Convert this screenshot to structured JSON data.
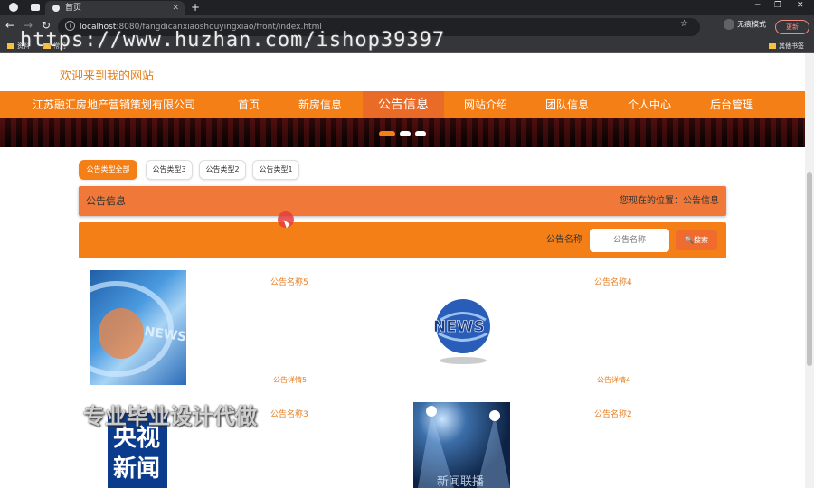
{
  "browser": {
    "tab_title": "首页",
    "url_host": "localhost",
    "url_rest": ":8080/fangdicanxiaoshouyingxiao/front/index.html",
    "incognito_label": "无痕模式",
    "update_label": "更新",
    "bookmarks": [
      "资料",
      "常用"
    ],
    "other_bookmarks": "其他书签"
  },
  "watermark": {
    "url": "https://www.huzhan.com/ishop39397",
    "bottom": "专业毕业设计代做"
  },
  "site": {
    "welcome": "欢迎来到我的网站",
    "company": "江苏融汇房地产营销策划有限公司",
    "nav": [
      "首页",
      "新房信息",
      "公告信息",
      "网站介绍",
      "团队信息",
      "个人中心",
      "后台管理"
    ],
    "nav_active_index": 2
  },
  "categories": [
    "公告类型全部",
    "公告类型3",
    "公告类型2",
    "公告类型1"
  ],
  "section": {
    "title": "公告信息",
    "location": "您现在的位置：公告信息"
  },
  "search": {
    "label": "公告名称",
    "placeholder": "公告名称",
    "button": "搜索"
  },
  "notices": [
    {
      "name": "公告名称5",
      "detail": "公告详情5",
      "image": "news-globe-photo"
    },
    {
      "name": "公告名称4",
      "detail": "公告详情4",
      "image": "news-globe-logo"
    },
    {
      "name": "公告名称3",
      "detail": "",
      "image": "cctv-news-logo",
      "image_text": "央视新闻"
    },
    {
      "name": "公告名称2",
      "detail": "",
      "image": "stage-spotlights-photo",
      "image_text": "新闻联播"
    }
  ],
  "colors": {
    "accent": "#f57f17",
    "active": "#e96b27",
    "text_accent": "#e67e22"
  }
}
